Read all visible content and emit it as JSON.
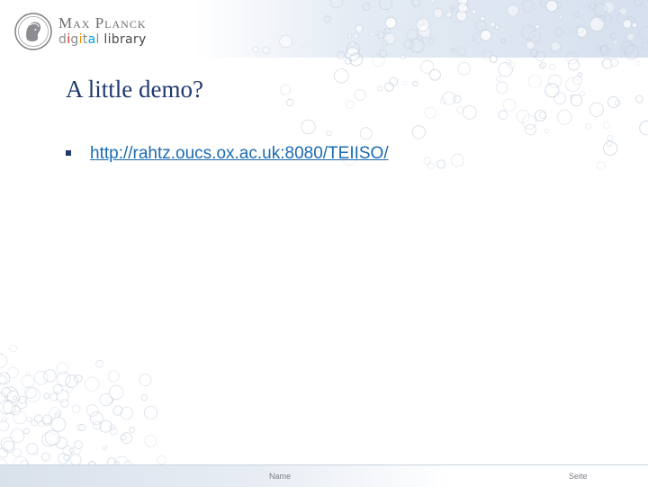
{
  "brand": {
    "name": "Max Planck",
    "sub_letters": [
      {
        "ch": "d",
        "color": "#8a8c8e"
      },
      {
        "ch": "i",
        "color": "#e2231a"
      },
      {
        "ch": "g",
        "color": "#8a8c8e"
      },
      {
        "ch": "i",
        "color": "#f39200"
      },
      {
        "ch": "t",
        "color": "#8a8c8e"
      },
      {
        "ch": "a",
        "color": "#009fe3"
      },
      {
        "ch": "l",
        "color": "#8a8c8e"
      },
      {
        "ch": " library",
        "color": "#4a4a4a"
      }
    ]
  },
  "slide": {
    "title": "A little demo?",
    "bullets": [
      {
        "text": "http://rahtz.oucs.ox.ac.uk:8080/TEIISO/",
        "href": "http://rahtz.oucs.ox.ac.uk:8080/TEIISO/"
      }
    ]
  },
  "footer": {
    "name": "Name",
    "page": "Seite"
  },
  "colors": {
    "title": "#1f3a6e",
    "link": "#1b6bb0",
    "bullet": "#1f3a6e"
  }
}
